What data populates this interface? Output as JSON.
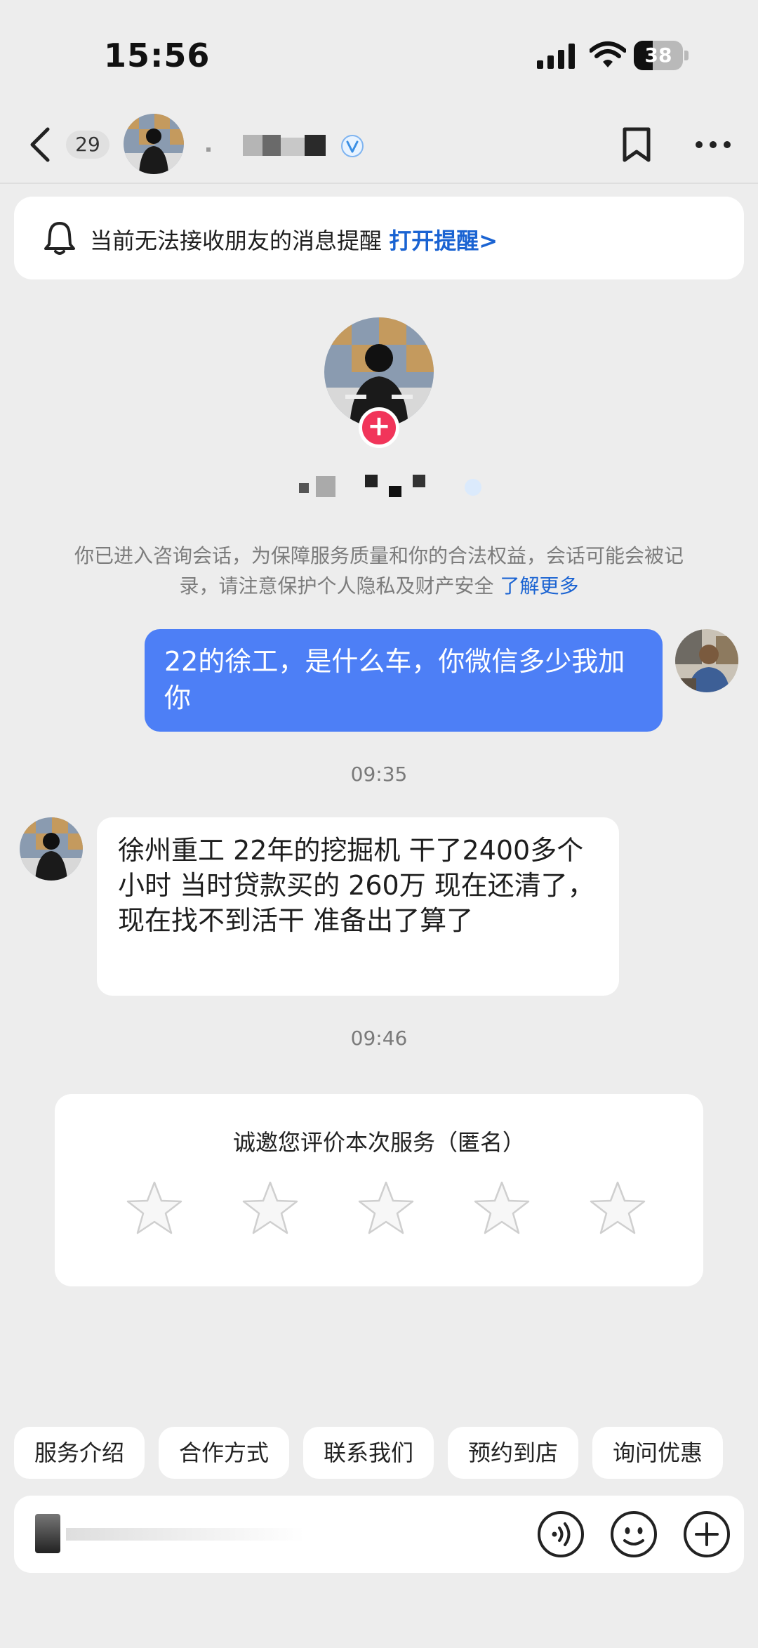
{
  "status_bar": {
    "time": "15:56",
    "battery": "38"
  },
  "header": {
    "unread_count": "29"
  },
  "notice": {
    "text": "当前无法接收朋友的消息提醒",
    "link": "打开提醒>"
  },
  "consult": {
    "text": "你已进入咨询会话，为保障服务质量和你的合法权益，会话可能会被记录，请注意保护个人隐私及财产安全",
    "link": "了解更多"
  },
  "messages": [
    {
      "from": "me",
      "text": "22的徐工，是什么车，你微信多少我加你"
    },
    {
      "type": "timestamp",
      "text": "09:35"
    },
    {
      "from": "other",
      "text": "徐州重工  22年的挖掘机  干了2400多个小时  当时贷款买的  260万  现在还清了，现在找不到活干  准备出了算了"
    },
    {
      "type": "timestamp",
      "text": "09:46"
    }
  ],
  "rating": {
    "title": "诚邀您评价本次服务（匿名）",
    "star_count": 5,
    "selected": 0
  },
  "quick_replies": [
    "服务介绍",
    "合作方式",
    "联系我们",
    "预约到店",
    "询问优惠"
  ],
  "colors": {
    "accent_blue": "#4d7ff6",
    "link_blue": "#1a63d2",
    "add_red": "#f1355a",
    "background": "#ededed"
  }
}
